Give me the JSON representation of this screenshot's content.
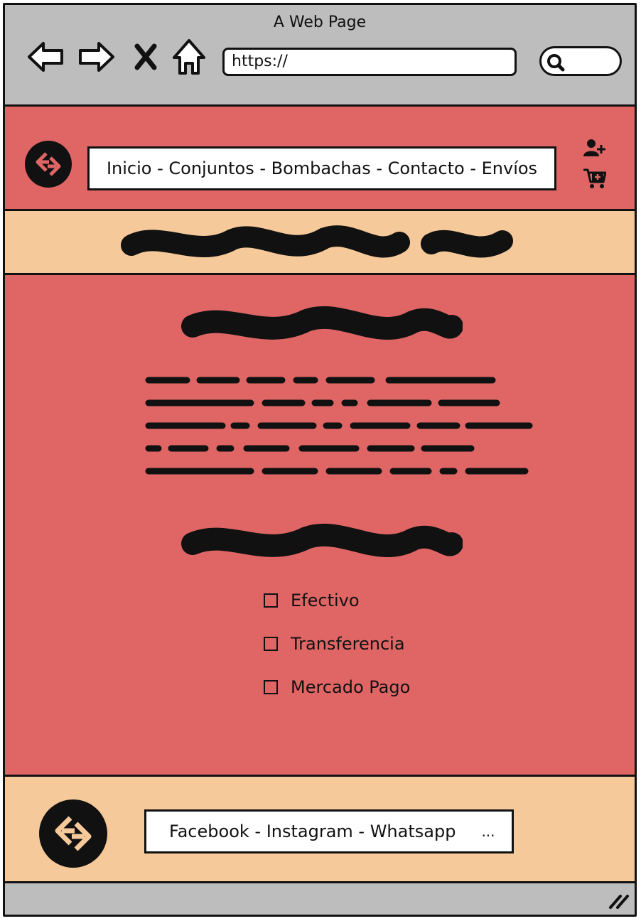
{
  "browser": {
    "title": "A Web Page",
    "url": "https://"
  },
  "header": {
    "menu": "Inicio - Conjuntos - Bombachas - Contacto - Envíos"
  },
  "payments": {
    "options": [
      "Efectivo",
      "Transferencia",
      "Mercado Pago"
    ]
  },
  "footer": {
    "social": "Facebook - Instagram - Whatsapp",
    "more": "..."
  },
  "colors": {
    "chrome": "#bdbdbd",
    "primary": "#e06666",
    "accent": "#f6c99a",
    "ink": "#111111"
  }
}
